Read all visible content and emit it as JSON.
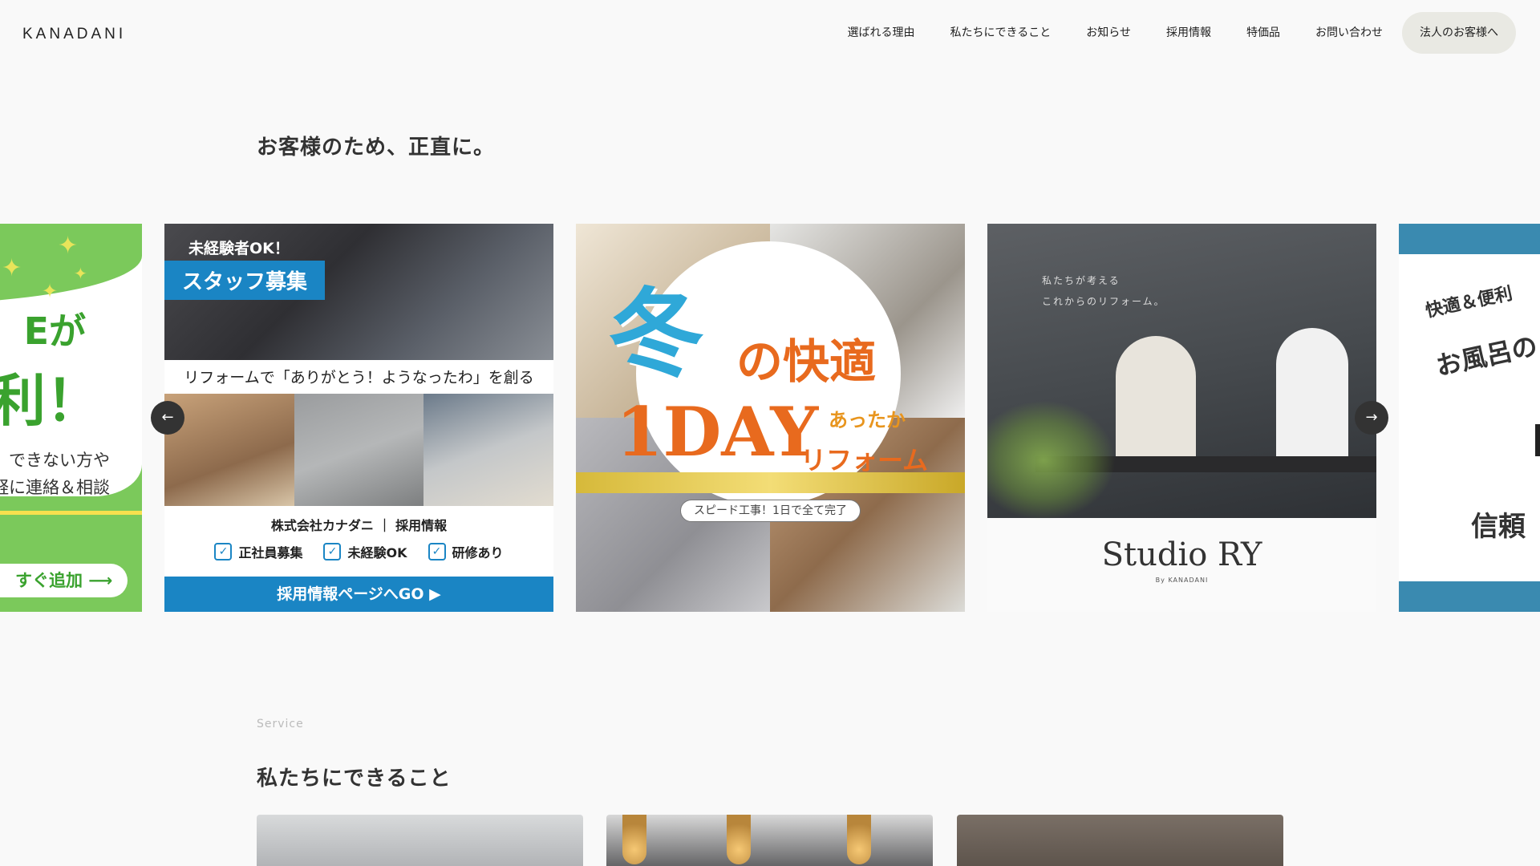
{
  "header": {
    "logo": "KANADANI",
    "nav": [
      "選ばれる理由",
      "私たちにできること",
      "お知らせ",
      "採用情報",
      "特価品",
      "お問い合わせ"
    ],
    "cta": "法人のお客様へ"
  },
  "hero": {
    "tagline": "お客様のため、正直に。"
  },
  "carousel": {
    "prev_label": "←",
    "next_label": "→",
    "line_banner": {
      "title_a": "Eが",
      "title_b": "利！",
      "body_1": "できない方や",
      "body_2": "軽に連絡＆相談",
      "button": "すぐ追加 ⟶"
    },
    "recruit": {
      "badge_1": "未経験者OK！",
      "badge_2": "スタッフ募集",
      "band": "リフォームで「ありがとう！ようなったわ」を創る",
      "company": "株式会社カナダニ ｜ 採用情報",
      "checks": [
        "正社員募集",
        "未経験OK",
        "研修あり"
      ],
      "cta": "採用情報ページへGO ▶"
    },
    "winter": {
      "winter": "冬",
      "comfort": "の快適",
      "warm": "あったか",
      "oneday": "1DAY",
      "reform": "リフォーム",
      "speed": "スピード工事！1日で全て完了"
    },
    "studio": {
      "copy_1": "私たちが考える",
      "copy_2": "これからのリフォーム。",
      "brand": "Studio RY",
      "by": "By KANADANI"
    },
    "bath": {
      "t1": "快適＆便利",
      "t2": "お風呂の",
      "t3": "信頼"
    }
  },
  "service": {
    "label_en": "Service",
    "title": "私たちにできること"
  }
}
